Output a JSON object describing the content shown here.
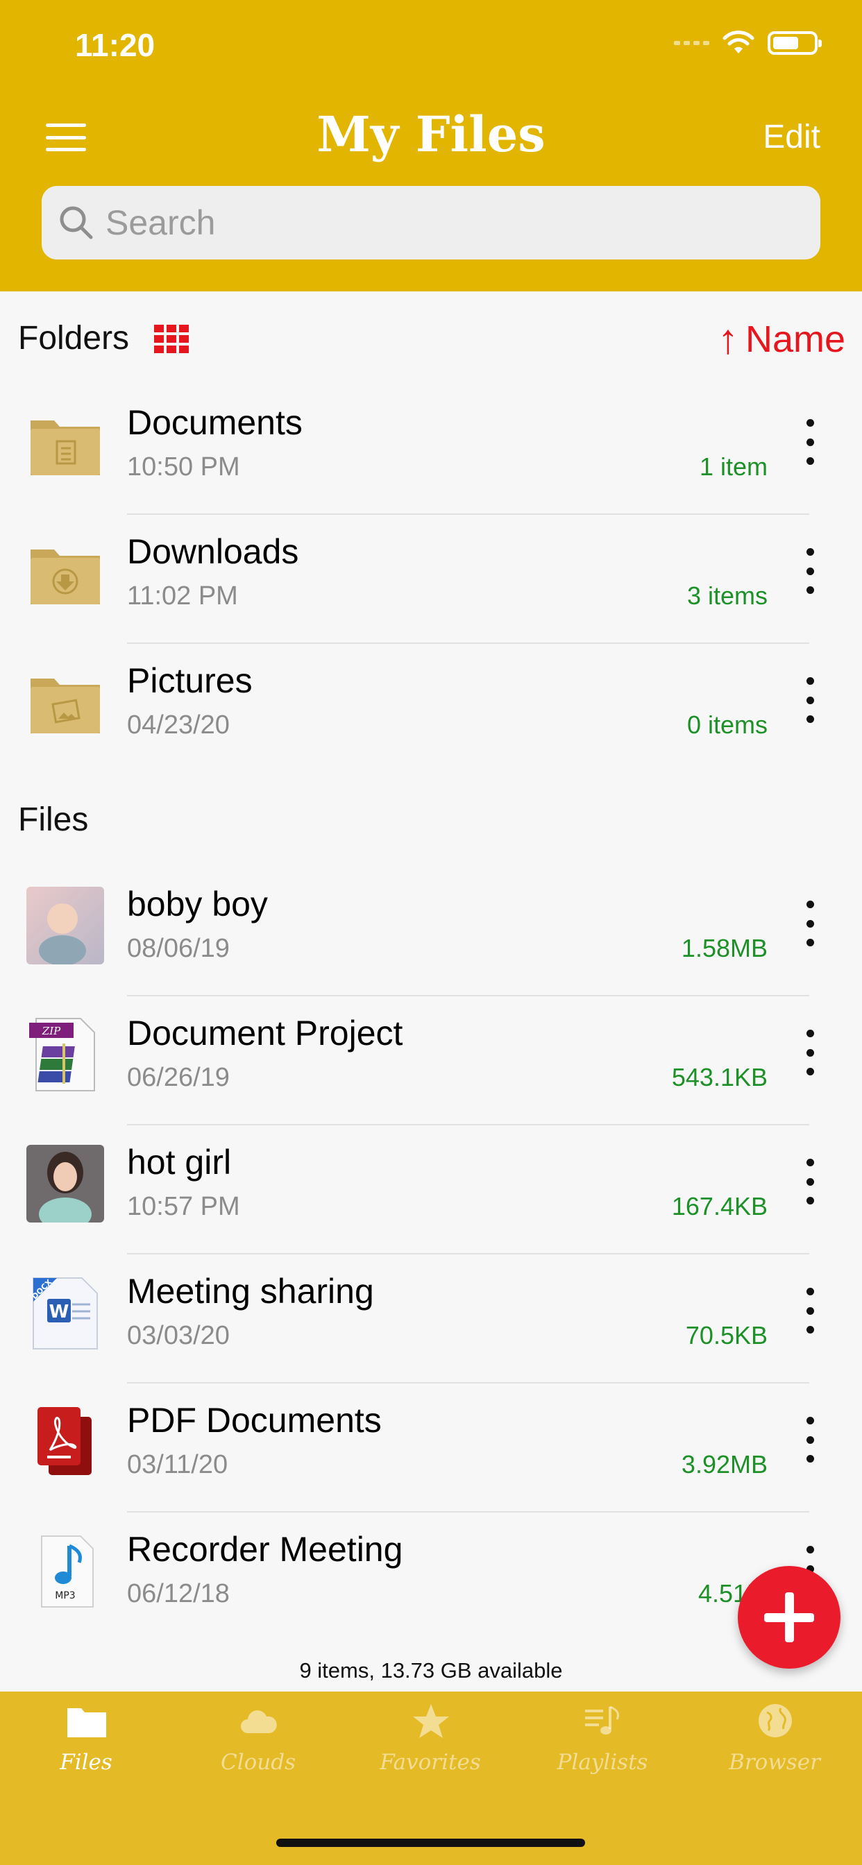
{
  "status_bar": {
    "time": "11:20"
  },
  "header": {
    "title": "My Files",
    "edit_label": "Edit"
  },
  "search": {
    "placeholder": "Search"
  },
  "folders_section": {
    "title": "Folders",
    "sort_label": "Name",
    "sort_arrow": "↑"
  },
  "folders": [
    {
      "name": "Documents",
      "date": "10:50 PM",
      "meta": "1 item",
      "icon": "folder-document-icon"
    },
    {
      "name": "Downloads",
      "date": "11:02 PM",
      "meta": "3 items",
      "icon": "folder-download-icon"
    },
    {
      "name": "Pictures",
      "date": "04/23/20",
      "meta": "0 items",
      "icon": "folder-pictures-icon"
    }
  ],
  "files_section": {
    "title": "Files"
  },
  "files": [
    {
      "name": "boby boy",
      "date": "08/06/19",
      "meta": "1.58MB",
      "icon": "photo-thumbnail"
    },
    {
      "name": "Document Project",
      "date": "06/26/19",
      "meta": "543.1KB",
      "icon": "zip-archive-icon",
      "badge": "ZIP"
    },
    {
      "name": "hot girl",
      "date": "10:57 PM",
      "meta": "167.4KB",
      "icon": "photo-thumbnail"
    },
    {
      "name": "Meeting sharing",
      "date": "03/03/20",
      "meta": "70.5KB",
      "icon": "word-document-icon",
      "badge": "DOCX"
    },
    {
      "name": "PDF Documents",
      "date": "03/11/20",
      "meta": "3.92MB",
      "icon": "pdf-document-icon"
    },
    {
      "name": "Recorder Meeting",
      "date": "06/12/18",
      "meta": "4.51M",
      "icon": "mp3-audio-icon",
      "badge": "MP3"
    }
  ],
  "summary": "9 items, 13.73 GB available",
  "tabs": [
    {
      "label": "Files",
      "active": true,
      "icon": "folder-icon"
    },
    {
      "label": "Clouds",
      "active": false,
      "icon": "cloud-icon"
    },
    {
      "label": "Favorites",
      "active": false,
      "icon": "star-icon"
    },
    {
      "label": "Playlists",
      "active": false,
      "icon": "playlist-icon"
    },
    {
      "label": "Browser",
      "active": false,
      "icon": "globe-icon"
    }
  ],
  "colors": {
    "header": "#e1b500",
    "tabbar": "#e4ba26",
    "accent_red": "#e5161d",
    "size_green": "#1d9128"
  }
}
